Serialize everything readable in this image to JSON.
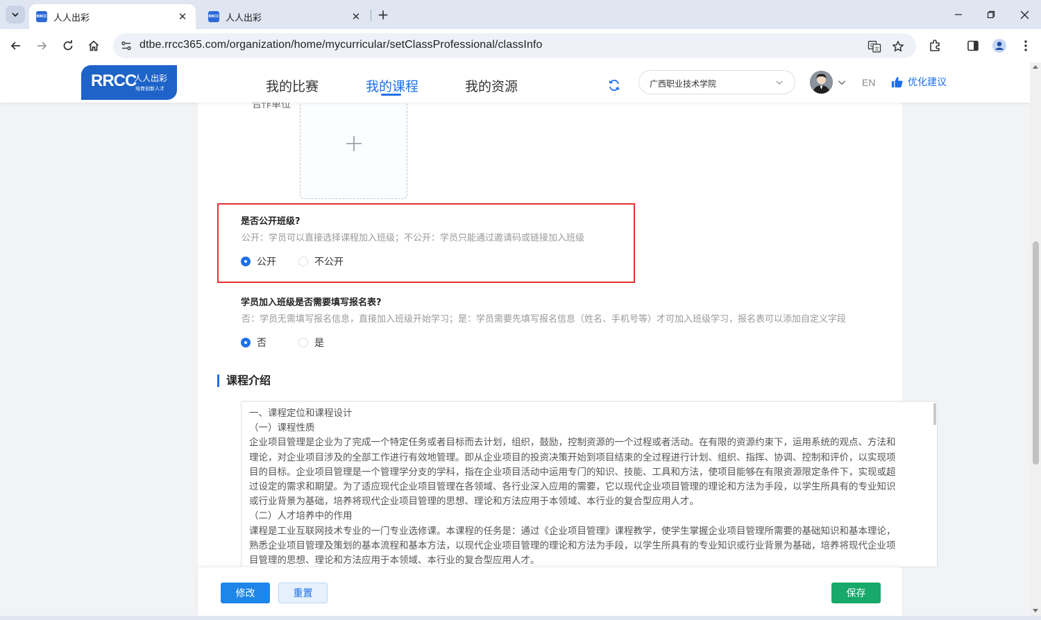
{
  "browser": {
    "tabs": [
      {
        "title": "人人出彩",
        "favicon": "RRCC",
        "active": true
      },
      {
        "title": "人人出彩",
        "favicon": "RRCC",
        "active": false
      }
    ],
    "url": "dtbe.rrcc365.com/organization/home/mycurricular/setClassProfessional/classInfo"
  },
  "header": {
    "logo": {
      "main": "RRCC",
      "cn": "人人出彩",
      "sub": "培育创新人才"
    },
    "nav": [
      {
        "label": "我的比赛",
        "active": false
      },
      {
        "label": "我的课程",
        "active": true
      },
      {
        "label": "我的资源",
        "active": false
      }
    ],
    "school_select": "广西职业技术学院",
    "language": "EN",
    "suggest": "优化建议"
  },
  "form": {
    "coop_label": "合作单位",
    "public_class": {
      "title": "是否公开班级?",
      "desc": "公开：学员可以直接选择课程加入班级；不公开：学员只能通过邀请码或链接加入班级",
      "options": [
        {
          "label": "公开",
          "checked": true
        },
        {
          "label": "不公开",
          "checked": false
        }
      ]
    },
    "signup_form": {
      "title": "学员加入班级是否需要填写报名表?",
      "desc": "否：学员无需填写报名信息，直接加入班级开始学习；是：学员需要先填写报名信息（姓名、手机号等）才可加入班级学习，报名表可以添加自定义字段",
      "options": [
        {
          "label": "否",
          "checked": true
        },
        {
          "label": "是",
          "checked": false
        }
      ]
    },
    "intro": {
      "section_title": "课程介绍",
      "lines": [
        "一、课程定位和课程设计",
        "（一）课程性质",
        "企业项目管理是企业为了完成一个特定任务或者目标而去计划，组织，鼓励，控制资源的一个过程或者活动。在有限的资源约束下，运用系统的观点、方法和",
        "理论，对企业项目涉及的全部工作进行有效地管理。即从企业项目的投资决策开始到项目结束的全过程进行计划、组织、指挥、协调、控制和评价，以实现项",
        "目的目标。企业项目管理是一个管理学分支的学科，指在企业项目活动中运用专门的知识、技能、工具和方法，使项目能够在有限资源限定条件下，实现或超",
        "过设定的需求和期望。为了适应现代企业项目管理在各领域、各行业深入应用的需要，它以现代企业项目管理的理论和方法为手段，以学生所具有的专业知识",
        "或行业背景为基础，培养将现代企业项目管理的思想、理论和方法应用于本领域、本行业的复合型应用人才。",
        "（二）人才培养中的作用",
        "课程是工业互联网技术专业的一门专业选修课。本课程的任务是：通过《企业项目管理》课程教学，使学生掌握企业项目管理所需要的基础知识和基本理论，",
        "熟悉企业项目管理及策划的基本流程和基本方法，以现代企业项目管理的理论和方法为手段，以学生所具有的专业知识或行业背景为基础，培养将现代企业项",
        "目管理的思想、理论和方法应用于本领域、本行业的复合型应用人才。"
      ]
    }
  },
  "footer": {
    "modify": "修改",
    "reset": "重置",
    "save": "保存"
  },
  "colors": {
    "accent": "#1e6fe8",
    "highlight": "#e52f2f",
    "save": "#17a86a"
  }
}
